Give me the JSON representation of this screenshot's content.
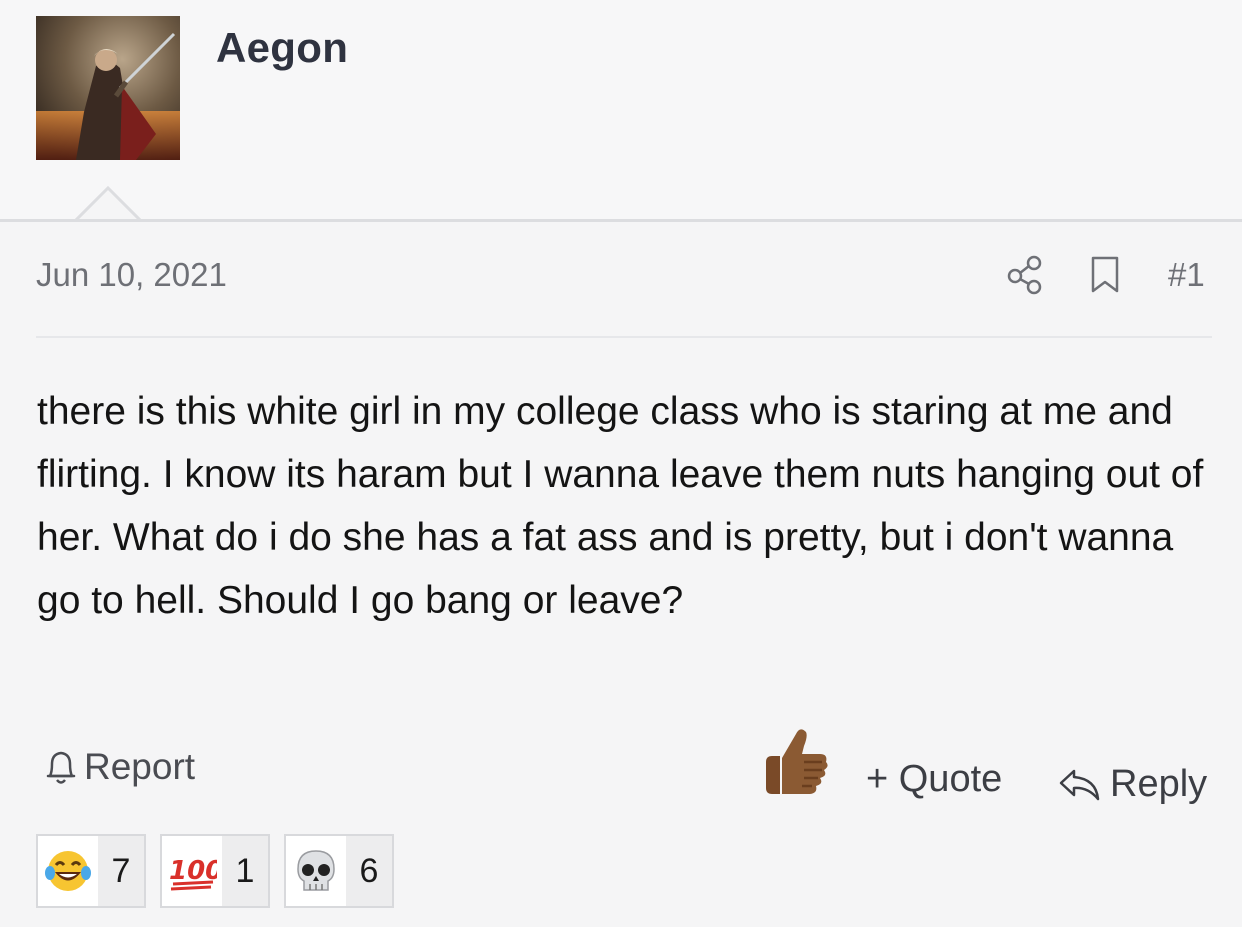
{
  "user": {
    "name": "Aegon"
  },
  "post": {
    "date": "Jun 10, 2021",
    "number": "#1",
    "body": "there is this white girl in my college class who is staring at me and flirting. I know its haram but I wanna leave them nuts hanging out of her. What do i do she has a fat ass and is pretty, but i don't wanna go to hell. Should I go bang or leave?"
  },
  "actions": {
    "report": "Report",
    "quote": "+ Quote",
    "reply": "Reply"
  },
  "reactions": [
    {
      "emoji": "😂",
      "icon": "laughing-tears-icon",
      "count": "7"
    },
    {
      "emoji": "💯",
      "icon": "hundred-points-icon",
      "count": "1"
    },
    {
      "emoji": "💀",
      "icon": "skull-icon",
      "count": "6"
    }
  ],
  "colors": {
    "text": "#141414",
    "muted": "#6e7076",
    "username": "#2f3340",
    "background": "#f5f5f6"
  }
}
